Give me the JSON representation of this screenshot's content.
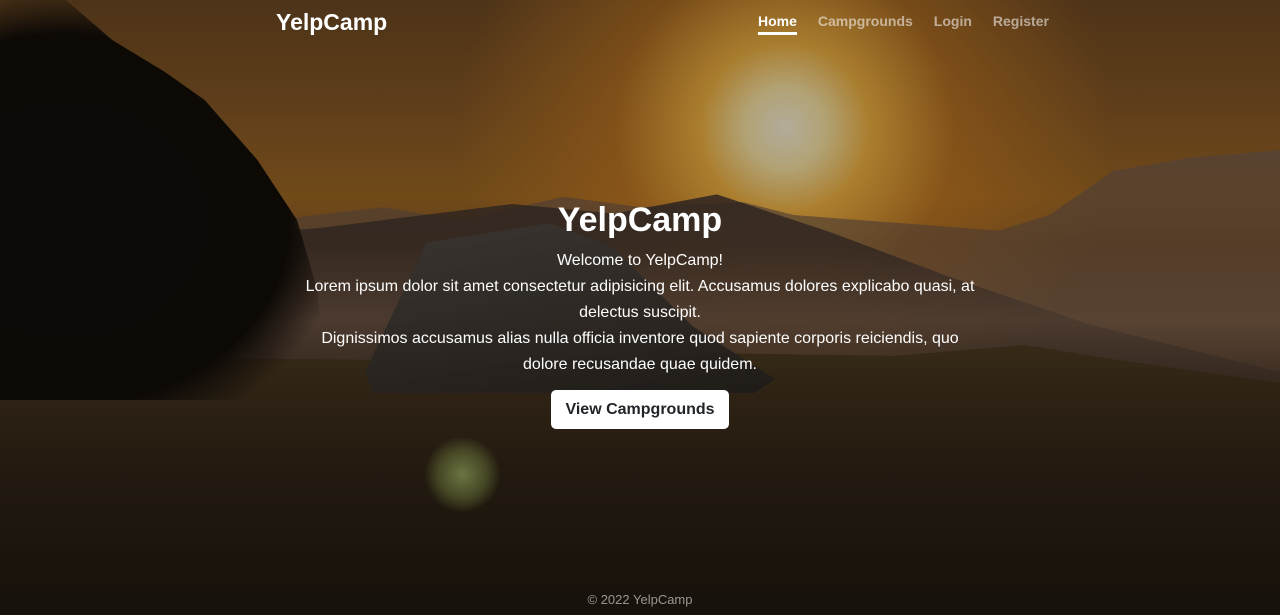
{
  "navbar": {
    "brand": "YelpCamp",
    "links": [
      {
        "label": "Home",
        "active": true
      },
      {
        "label": "Campgrounds",
        "active": false
      },
      {
        "label": "Login",
        "active": false
      },
      {
        "label": "Register",
        "active": false
      }
    ]
  },
  "hero": {
    "title": "YelpCamp",
    "welcome": "Welcome to YelpCamp!",
    "paragraph_1": "Lorem ipsum dolor sit amet consectetur adipisicing elit. Accusamus dolores explicabo quasi, at delectus suscipit.",
    "paragraph_2": "Dignissimos accusamus alias nulla officia inventore quod sapiente corporis reiciendis, quo dolore recusandae quae quidem.",
    "button_label": "View Campgrounds"
  },
  "footer": {
    "text": "© 2022 YelpCamp"
  },
  "colors": {
    "overlay": "#000000",
    "button_bg": "#ffffff",
    "button_text": "#212529",
    "nav_inactive": "#999999"
  }
}
